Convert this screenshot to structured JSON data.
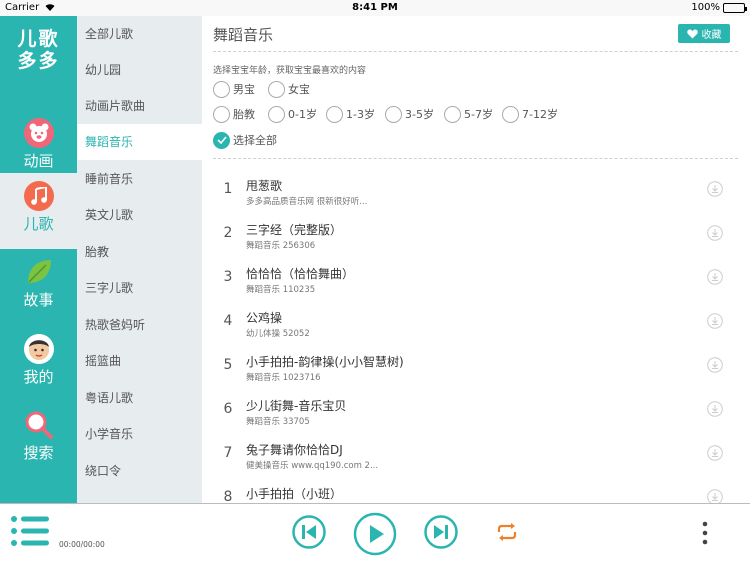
{
  "status_bar": {
    "carrier": "Carrier",
    "time": "8:41 PM",
    "battery": "100%"
  },
  "app": {
    "logo_line1": "儿歌",
    "logo_line2": "多多"
  },
  "nav": [
    {
      "label": "动画",
      "icon": "bear-icon",
      "color": "#f0677a"
    },
    {
      "label": "儿歌",
      "icon": "music-note-icon",
      "color": "#f46a4e"
    },
    {
      "label": "故事",
      "icon": "leaf-icon",
      "color": "#7cc243"
    },
    {
      "label": "我的",
      "icon": "boy-avatar-icon",
      "color": "#f2c9a0"
    },
    {
      "label": "搜索",
      "icon": "search-icon",
      "color": "#f0677a"
    }
  ],
  "nav_active": "儿歌",
  "categories": [
    "全部儿歌",
    "幼儿园",
    "动画片歌曲",
    "舞蹈音乐",
    "睡前音乐",
    "英文儿歌",
    "胎教",
    "三字儿歌",
    "热歌爸妈听",
    "摇篮曲",
    "粤语儿歌",
    "小学音乐",
    "绕口令"
  ],
  "category_active": "舞蹈音乐",
  "page": {
    "title": "舞蹈音乐",
    "favorite_label": "收藏",
    "filter_hint": "选择宝宝年龄，获取宝宝最喜欢的内容"
  },
  "gender_options": [
    "男宝",
    "女宝"
  ],
  "age_options": [
    "胎教",
    "0-1岁",
    "1-3岁",
    "3-5岁",
    "5-7岁",
    "7-12岁"
  ],
  "select_all_label": "选择全部",
  "tracks": [
    {
      "num": "1",
      "name": "甩葱歌",
      "sub": "多多高品质音乐网 很新很好听..."
    },
    {
      "num": "2",
      "name": "三字经（完整版）",
      "sub": "舞蹈音乐 256306"
    },
    {
      "num": "3",
      "name": "恰恰恰（恰恰舞曲）",
      "sub": "舞蹈音乐 110235"
    },
    {
      "num": "4",
      "name": "公鸡操",
      "sub": "幼儿体操 52052"
    },
    {
      "num": "5",
      "name": "小手拍拍-韵律操(小小智慧树)",
      "sub": "舞蹈音乐 1023716"
    },
    {
      "num": "6",
      "name": "少儿街舞-音乐宝贝",
      "sub": "舞蹈音乐 33705"
    },
    {
      "num": "7",
      "name": "兔子舞请你恰恰DJ",
      "sub": "健美操音乐 www.qq190.com 2..."
    },
    {
      "num": "8",
      "name": "小手拍拍（小班）",
      "sub": ""
    }
  ],
  "player": {
    "time": "00:00/00:00",
    "accent": "#2bb5b0",
    "repeat_color": "#f07f2a"
  }
}
